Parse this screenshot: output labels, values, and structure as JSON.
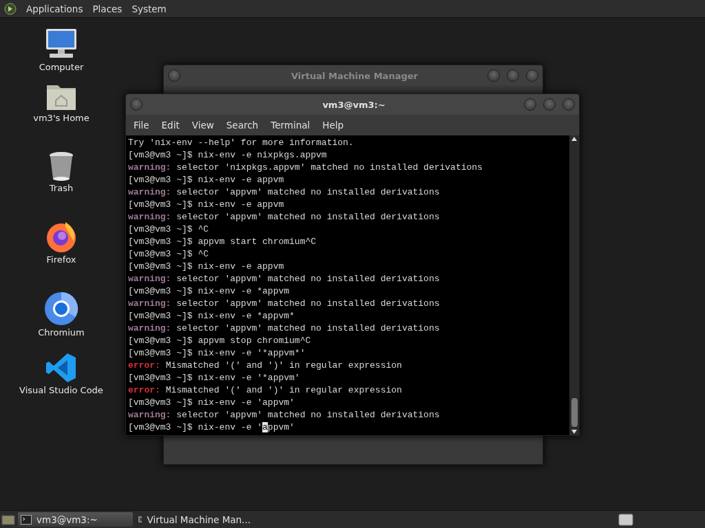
{
  "top_panel": {
    "menus": [
      "Applications",
      "Places",
      "System"
    ]
  },
  "desktop_icons": [
    {
      "kind": "computer",
      "label": "Computer"
    },
    {
      "kind": "home",
      "label": "vm3's Home"
    },
    {
      "kind": "trash",
      "label": "Trash"
    },
    {
      "kind": "firefox",
      "label": "Firefox"
    },
    {
      "kind": "chromium",
      "label": "Chromium"
    },
    {
      "kind": "vscode",
      "label": "Visual Studio Code"
    }
  ],
  "background_window": {
    "title": "Virtual Machine Manager"
  },
  "terminal": {
    "title": "vm3@vm3:~",
    "menu": [
      "File",
      "Edit",
      "View",
      "Search",
      "Terminal",
      "Help"
    ],
    "lines": [
      {
        "kind": "plain",
        "text": "Try 'nix-env --help' for more information."
      },
      {
        "kind": "plain",
        "text": "[vm3@vm3 ~]$ nix-env -e nixpkgs.appvm"
      },
      {
        "kind": "warning",
        "tag": "warning:",
        "text": "selector 'nixpkgs.appvm' matched no installed derivations"
      },
      {
        "kind": "plain",
        "text": "[vm3@vm3 ~]$ nix-env -e appvm"
      },
      {
        "kind": "warning",
        "tag": "warning:",
        "text": "selector 'appvm' matched no installed derivations"
      },
      {
        "kind": "plain",
        "text": "[vm3@vm3 ~]$ nix-env -e appvm"
      },
      {
        "kind": "warning",
        "tag": "warning:",
        "text": "selector 'appvm' matched no installed derivations"
      },
      {
        "kind": "plain",
        "text": "[vm3@vm3 ~]$ ^C"
      },
      {
        "kind": "plain",
        "text": "[vm3@vm3 ~]$ appvm start chromium^C"
      },
      {
        "kind": "plain",
        "text": "[vm3@vm3 ~]$ ^C"
      },
      {
        "kind": "plain",
        "text": "[vm3@vm3 ~]$ nix-env -e appvm"
      },
      {
        "kind": "warning",
        "tag": "warning:",
        "text": "selector 'appvm' matched no installed derivations"
      },
      {
        "kind": "plain",
        "text": "[vm3@vm3 ~]$ nix-env -e *appvm"
      },
      {
        "kind": "warning",
        "tag": "warning:",
        "text": "selector 'appvm' matched no installed derivations"
      },
      {
        "kind": "plain",
        "text": "[vm3@vm3 ~]$ nix-env -e *appvm*"
      },
      {
        "kind": "warning",
        "tag": "warning:",
        "text": "selector 'appvm' matched no installed derivations"
      },
      {
        "kind": "plain",
        "text": "[vm3@vm3 ~]$ appvm stop chromium^C"
      },
      {
        "kind": "plain",
        "text": "[vm3@vm3 ~]$ nix-env -e '*appvm*'"
      },
      {
        "kind": "error",
        "tag": "error:",
        "text": "Mismatched '(' and ')' in regular expression"
      },
      {
        "kind": "plain",
        "text": "[vm3@vm3 ~]$ nix-env -e '*appvm'"
      },
      {
        "kind": "error",
        "tag": "error:",
        "text": "Mismatched '(' and ')' in regular expression"
      },
      {
        "kind": "plain",
        "text": "[vm3@vm3 ~]$ nix-env -e 'appvm'"
      },
      {
        "kind": "warning",
        "tag": "warning:",
        "text": "selector 'appvm' matched no installed derivations"
      },
      {
        "kind": "cursor",
        "text": "[vm3@vm3 ~]$ nix-env -e '",
        "cursor_char": "a",
        "rest": "ppvm'"
      }
    ]
  },
  "taskbar": {
    "tasks": [
      {
        "kind": "terminal",
        "label": "vm3@vm3:~",
        "selected": true
      },
      {
        "kind": "vmm",
        "label": "Virtual Machine Man...",
        "selected": false
      }
    ]
  }
}
